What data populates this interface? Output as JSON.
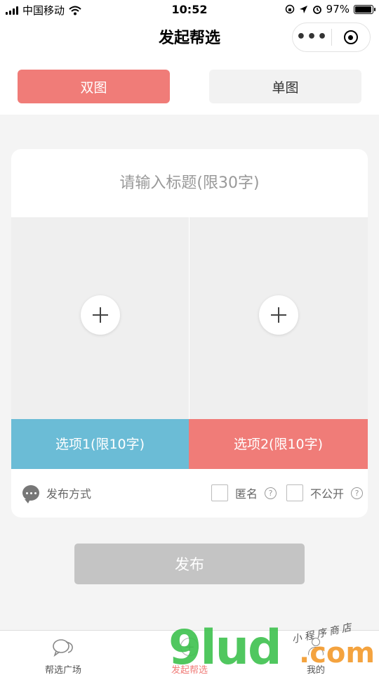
{
  "status_bar": {
    "carrier": "中国移动",
    "time": "10:52",
    "battery": "97%",
    "battery_level": 0.97
  },
  "nav": {
    "title": "发起帮选",
    "more_glyph": "•••"
  },
  "mode_tabs": {
    "double": "双图",
    "single": "单图",
    "selected": "双图",
    "active_color": "#f07c78"
  },
  "form": {
    "title_placeholder": "请输入标题(限30字)",
    "option1_placeholder": "选项1(限10字)",
    "option2_placeholder": "选项2(限10字)",
    "option1_color": "#6bbcd6",
    "option2_color": "#f07c78",
    "publish_method_label": "发布方式",
    "anonymous_label": "匿名",
    "private_label": "不公开",
    "help_glyph": "?"
  },
  "submit": {
    "label": "发布"
  },
  "tabbar": {
    "items": [
      {
        "label": "帮选广场",
        "icon": "chat-bubbles-icon"
      },
      {
        "label": "发起帮选",
        "icon": "add-circle-icon",
        "active": true
      },
      {
        "label": "我的",
        "icon": "person-icon"
      }
    ]
  },
  "watermark": {
    "main": "9lud",
    "suffix": ".com",
    "tagline": "小程序商店"
  }
}
